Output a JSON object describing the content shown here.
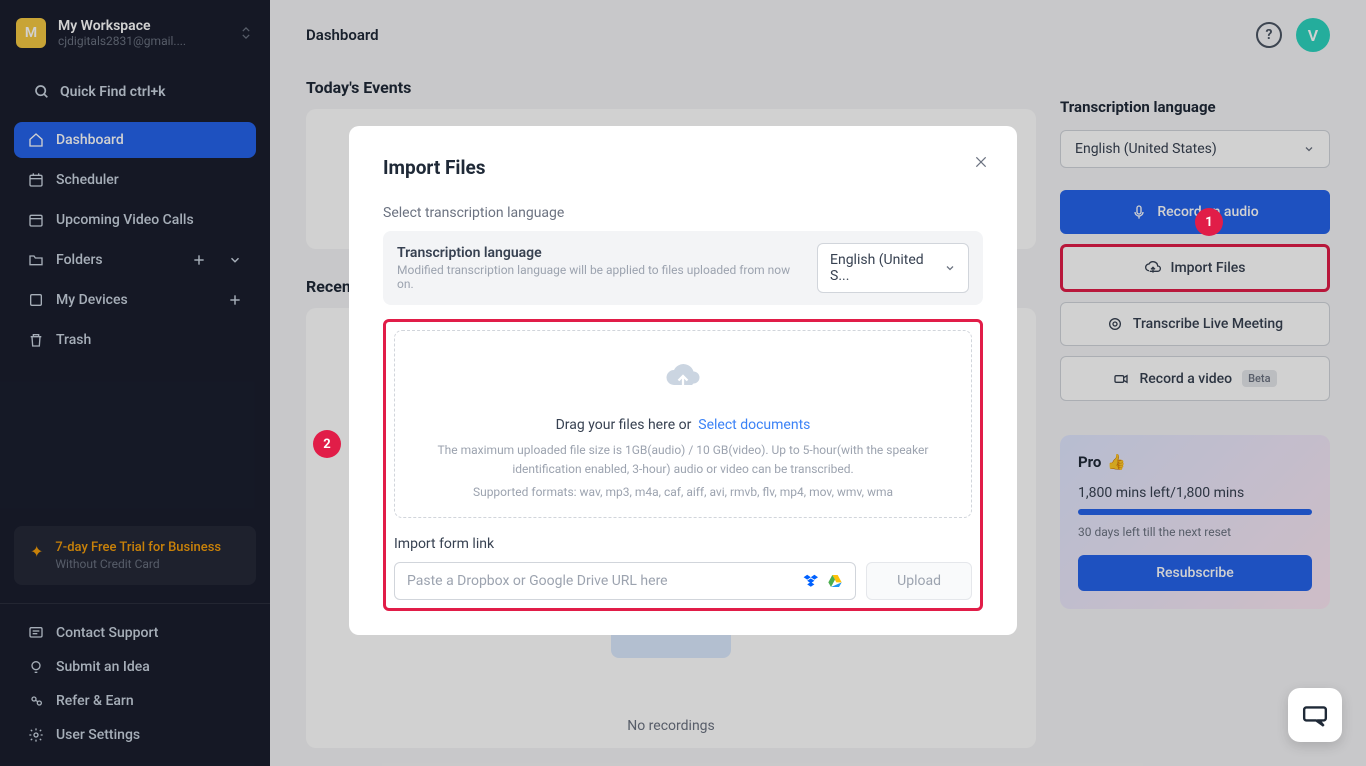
{
  "workspace": {
    "avatar_letter": "M",
    "name": "My Workspace",
    "email": "cjdigitals2831@gmail...."
  },
  "quickfind": {
    "label": "Quick Find ctrl+k"
  },
  "nav": {
    "dashboard": "Dashboard",
    "scheduler": "Scheduler",
    "upcoming": "Upcoming Video Calls",
    "folders": "Folders",
    "devices": "My Devices",
    "trash": "Trash"
  },
  "trial": {
    "title": "7-day Free Trial for Business",
    "sub": "Without Credit Card"
  },
  "bottom_nav": {
    "contact": "Contact Support",
    "submit": "Submit an Idea",
    "refer": "Refer & Earn",
    "settings": "User Settings"
  },
  "header": {
    "title": "Dashboard",
    "avatar_letter": "V"
  },
  "sections": {
    "events": "Today's Events",
    "recent": "Recent"
  },
  "recordings": {
    "empty": "No recordings"
  },
  "side": {
    "trans_lang_title": "Transcription language",
    "lang_value": "English (United States)",
    "record_audio": "Record an audio",
    "import_files": "Import Files",
    "transcribe_live": "Transcribe Live Meeting",
    "record_video": "Record a video",
    "beta": "Beta"
  },
  "pro": {
    "title": "Pro",
    "mins": "1,800 mins left/1,800 mins",
    "reset": "30 days left till the next reset",
    "resubscribe": "Resubscribe"
  },
  "modal": {
    "title": "Import Files",
    "subtitle": "Select transcription language",
    "lang_label": "Transcription language",
    "lang_desc": "Modified transcription language will be applied to files uploaded from now on.",
    "lang_value": "English (United S...",
    "drop_drag": "Drag your files here or",
    "drop_select": "Select documents",
    "drop_desc": "The maximum uploaded file size is 1GB(audio) / 10 GB(video). Up to 5-hour(with the speaker identification enabled, 3-hour) audio or video can be transcribed.",
    "drop_formats": "Supported formats: wav, mp3, m4a, caf, aiff, avi, rmvb, flv, mp4, mov, wmv, wma",
    "import_link_label": "Import form link",
    "link_placeholder": "Paste a Dropbox or Google Drive URL here",
    "upload": "Upload"
  },
  "annotations": {
    "one": "1",
    "two": "2"
  }
}
